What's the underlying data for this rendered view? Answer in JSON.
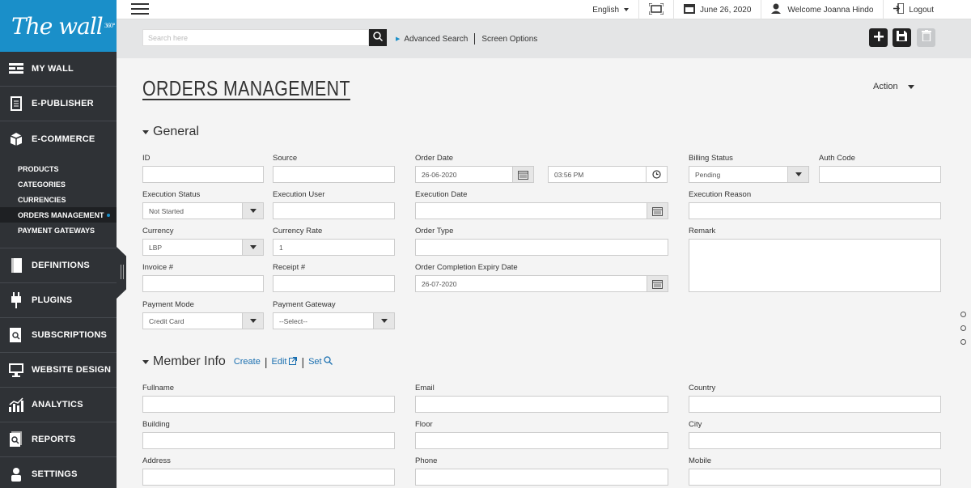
{
  "brand": {
    "name": "The wall",
    "version": "360°"
  },
  "sidebar": {
    "items": [
      {
        "label": "My Wall",
        "icon": "wall-icon"
      },
      {
        "label": "E-Publisher",
        "icon": "publisher-icon"
      },
      {
        "label": "E-Commerce",
        "icon": "commerce-icon"
      }
    ],
    "sub_items": [
      "Products",
      "Categories",
      "Currencies",
      "Orders Management",
      "Payment Gateways"
    ],
    "active_sub": "Orders Management",
    "items_bottom": [
      {
        "label": "Definitions",
        "icon": "definitions-icon"
      },
      {
        "label": "Plugins",
        "icon": "plugin-icon"
      },
      {
        "label": "Subscriptions",
        "icon": "subscriptions-icon"
      },
      {
        "label": "Website Design",
        "icon": "monitor-icon"
      },
      {
        "label": "Analytics",
        "icon": "analytics-icon"
      },
      {
        "label": "Reports",
        "icon": "reports-icon"
      },
      {
        "label": "Settings",
        "icon": "settings-icon"
      }
    ]
  },
  "topbar": {
    "language": "English",
    "date": "June 26, 2020",
    "welcome": "Welcome Joanna Hindo",
    "logout": "Logout"
  },
  "toolbar": {
    "search_placeholder": "Search here",
    "advanced_search": "Advanced Search",
    "screen_options": "Screen Options"
  },
  "page": {
    "title": "Orders Management",
    "action": "Action"
  },
  "general": {
    "heading": "General",
    "id": {
      "label": "ID",
      "value": ""
    },
    "source": {
      "label": "Source",
      "value": ""
    },
    "order_date": {
      "label": "Order Date",
      "value": "26-06-2020",
      "time": "03:56 PM"
    },
    "billing_status": {
      "label": "Billing Status",
      "value": "Pending"
    },
    "auth_code": {
      "label": "Auth Code",
      "value": ""
    },
    "execution_status": {
      "label": "Execution Status",
      "value": "Not Started"
    },
    "execution_user": {
      "label": "Execution User",
      "value": ""
    },
    "execution_date": {
      "label": "Execution Date",
      "value": ""
    },
    "execution_reason": {
      "label": "Execution Reason",
      "value": ""
    },
    "currency": {
      "label": "Currency",
      "value": "LBP"
    },
    "currency_rate": {
      "label": "Currency Rate",
      "value": "1"
    },
    "order_type": {
      "label": "Order Type",
      "value": ""
    },
    "remark": {
      "label": "Remark",
      "value": ""
    },
    "invoice": {
      "label": "Invoice #",
      "value": ""
    },
    "receipt": {
      "label": "Receipt #",
      "value": ""
    },
    "completion_expiry": {
      "label": "Order Completion Expiry Date",
      "value": "26-07-2020"
    },
    "payment_mode": {
      "label": "Payment Mode",
      "value": "Credit Card"
    },
    "payment_gateway": {
      "label": "Payment Gateway",
      "value": "--Select--"
    }
  },
  "member": {
    "heading": "Member Info",
    "create": "Create",
    "edit": "Edit",
    "set": "Set",
    "fullname": {
      "label": "Fullname",
      "value": ""
    },
    "email": {
      "label": "Email",
      "value": ""
    },
    "country": {
      "label": "Country",
      "value": ""
    },
    "building": {
      "label": "Building",
      "value": ""
    },
    "floor": {
      "label": "Floor",
      "value": ""
    },
    "city": {
      "label": "City",
      "value": ""
    },
    "address": {
      "label": "Address",
      "value": ""
    },
    "phone": {
      "label": "Phone",
      "value": ""
    },
    "mobile": {
      "label": "Mobile",
      "value": ""
    }
  },
  "colors": {
    "sidebar": "#2f3236",
    "brand": "#1a8fc9",
    "link": "#1a6fb0"
  }
}
